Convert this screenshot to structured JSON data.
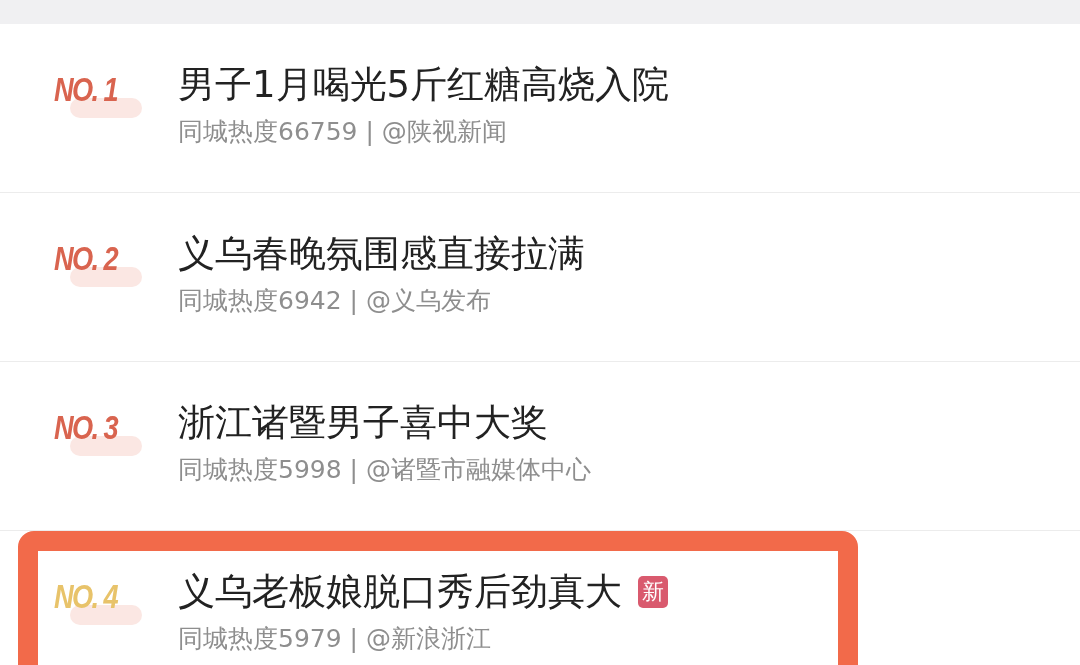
{
  "hot_list": [
    {
      "rank": "NO. 1",
      "title": "男子1月喝光5斤红糖高烧入院",
      "heat": "同城热度66759 | @陕视新闻",
      "color": "#d9644f",
      "is_new": false,
      "highlighted": false
    },
    {
      "rank": "NO. 2",
      "title": "义乌春晚氛围感直接拉满",
      "heat": "同城热度6942 | @义乌发布",
      "color": "#d9644f",
      "is_new": false,
      "highlighted": false
    },
    {
      "rank": "NO. 3",
      "title": "浙江诸暨男子喜中大奖",
      "heat": "同城热度5998 | @诸暨市融媒体中心",
      "color": "#d9644f",
      "is_new": false,
      "highlighted": false
    },
    {
      "rank": "NO. 4",
      "title": "义乌老板娘脱口秀后劲真大",
      "heat": "同城热度5979 | @新浪浙江",
      "color": "#e8c36a",
      "is_new": true,
      "new_label": "新",
      "highlighted": true
    }
  ]
}
